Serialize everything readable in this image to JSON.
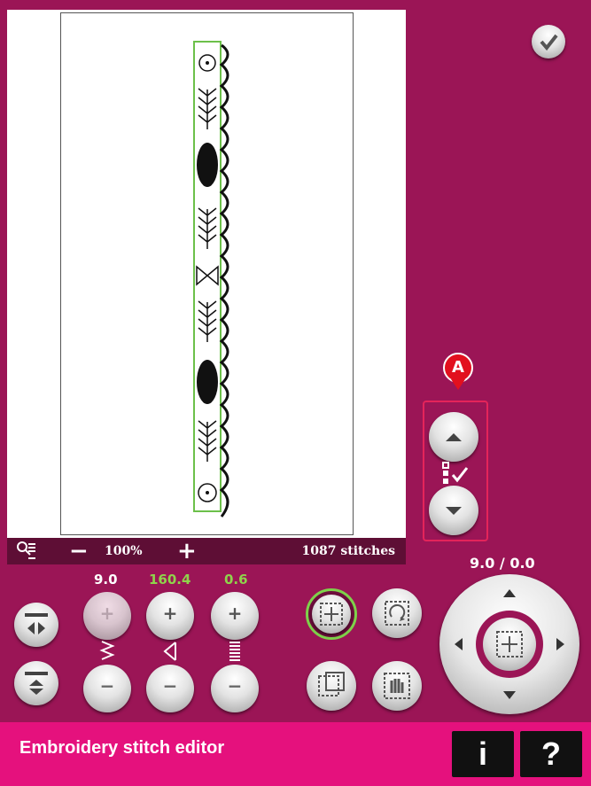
{
  "status_bar": {
    "zoom_minus": "−",
    "zoom_level": "100%",
    "zoom_plus": "+",
    "stitch_count": "1087 stitches"
  },
  "controls": {
    "width_value": "9.0",
    "length_value": "160.4",
    "density_value": "0.6",
    "plus_symbol": "+",
    "minus_symbol": "−"
  },
  "position_readout": "9.0 / 0.0",
  "marker_label": "A",
  "bottom_bar": {
    "title": "Embroidery stitch editor",
    "info_label": "i",
    "help_label": "?"
  },
  "colors": {
    "background": "#9b1556",
    "bottom_bar": "#e5117d",
    "highlight_green": "#8fd34b",
    "marker_red": "#e2101e"
  },
  "icons": [
    "ok-check-icon",
    "zoom-options-icon",
    "mirror-side-icon",
    "mirror-end-icon",
    "width-icon",
    "length-icon",
    "density-icon",
    "select-all-icon",
    "rotate-icon",
    "move-to-hoop-icon",
    "pan-icon",
    "arrow-up-icon",
    "arrow-down-icon",
    "select-check-icon"
  ]
}
